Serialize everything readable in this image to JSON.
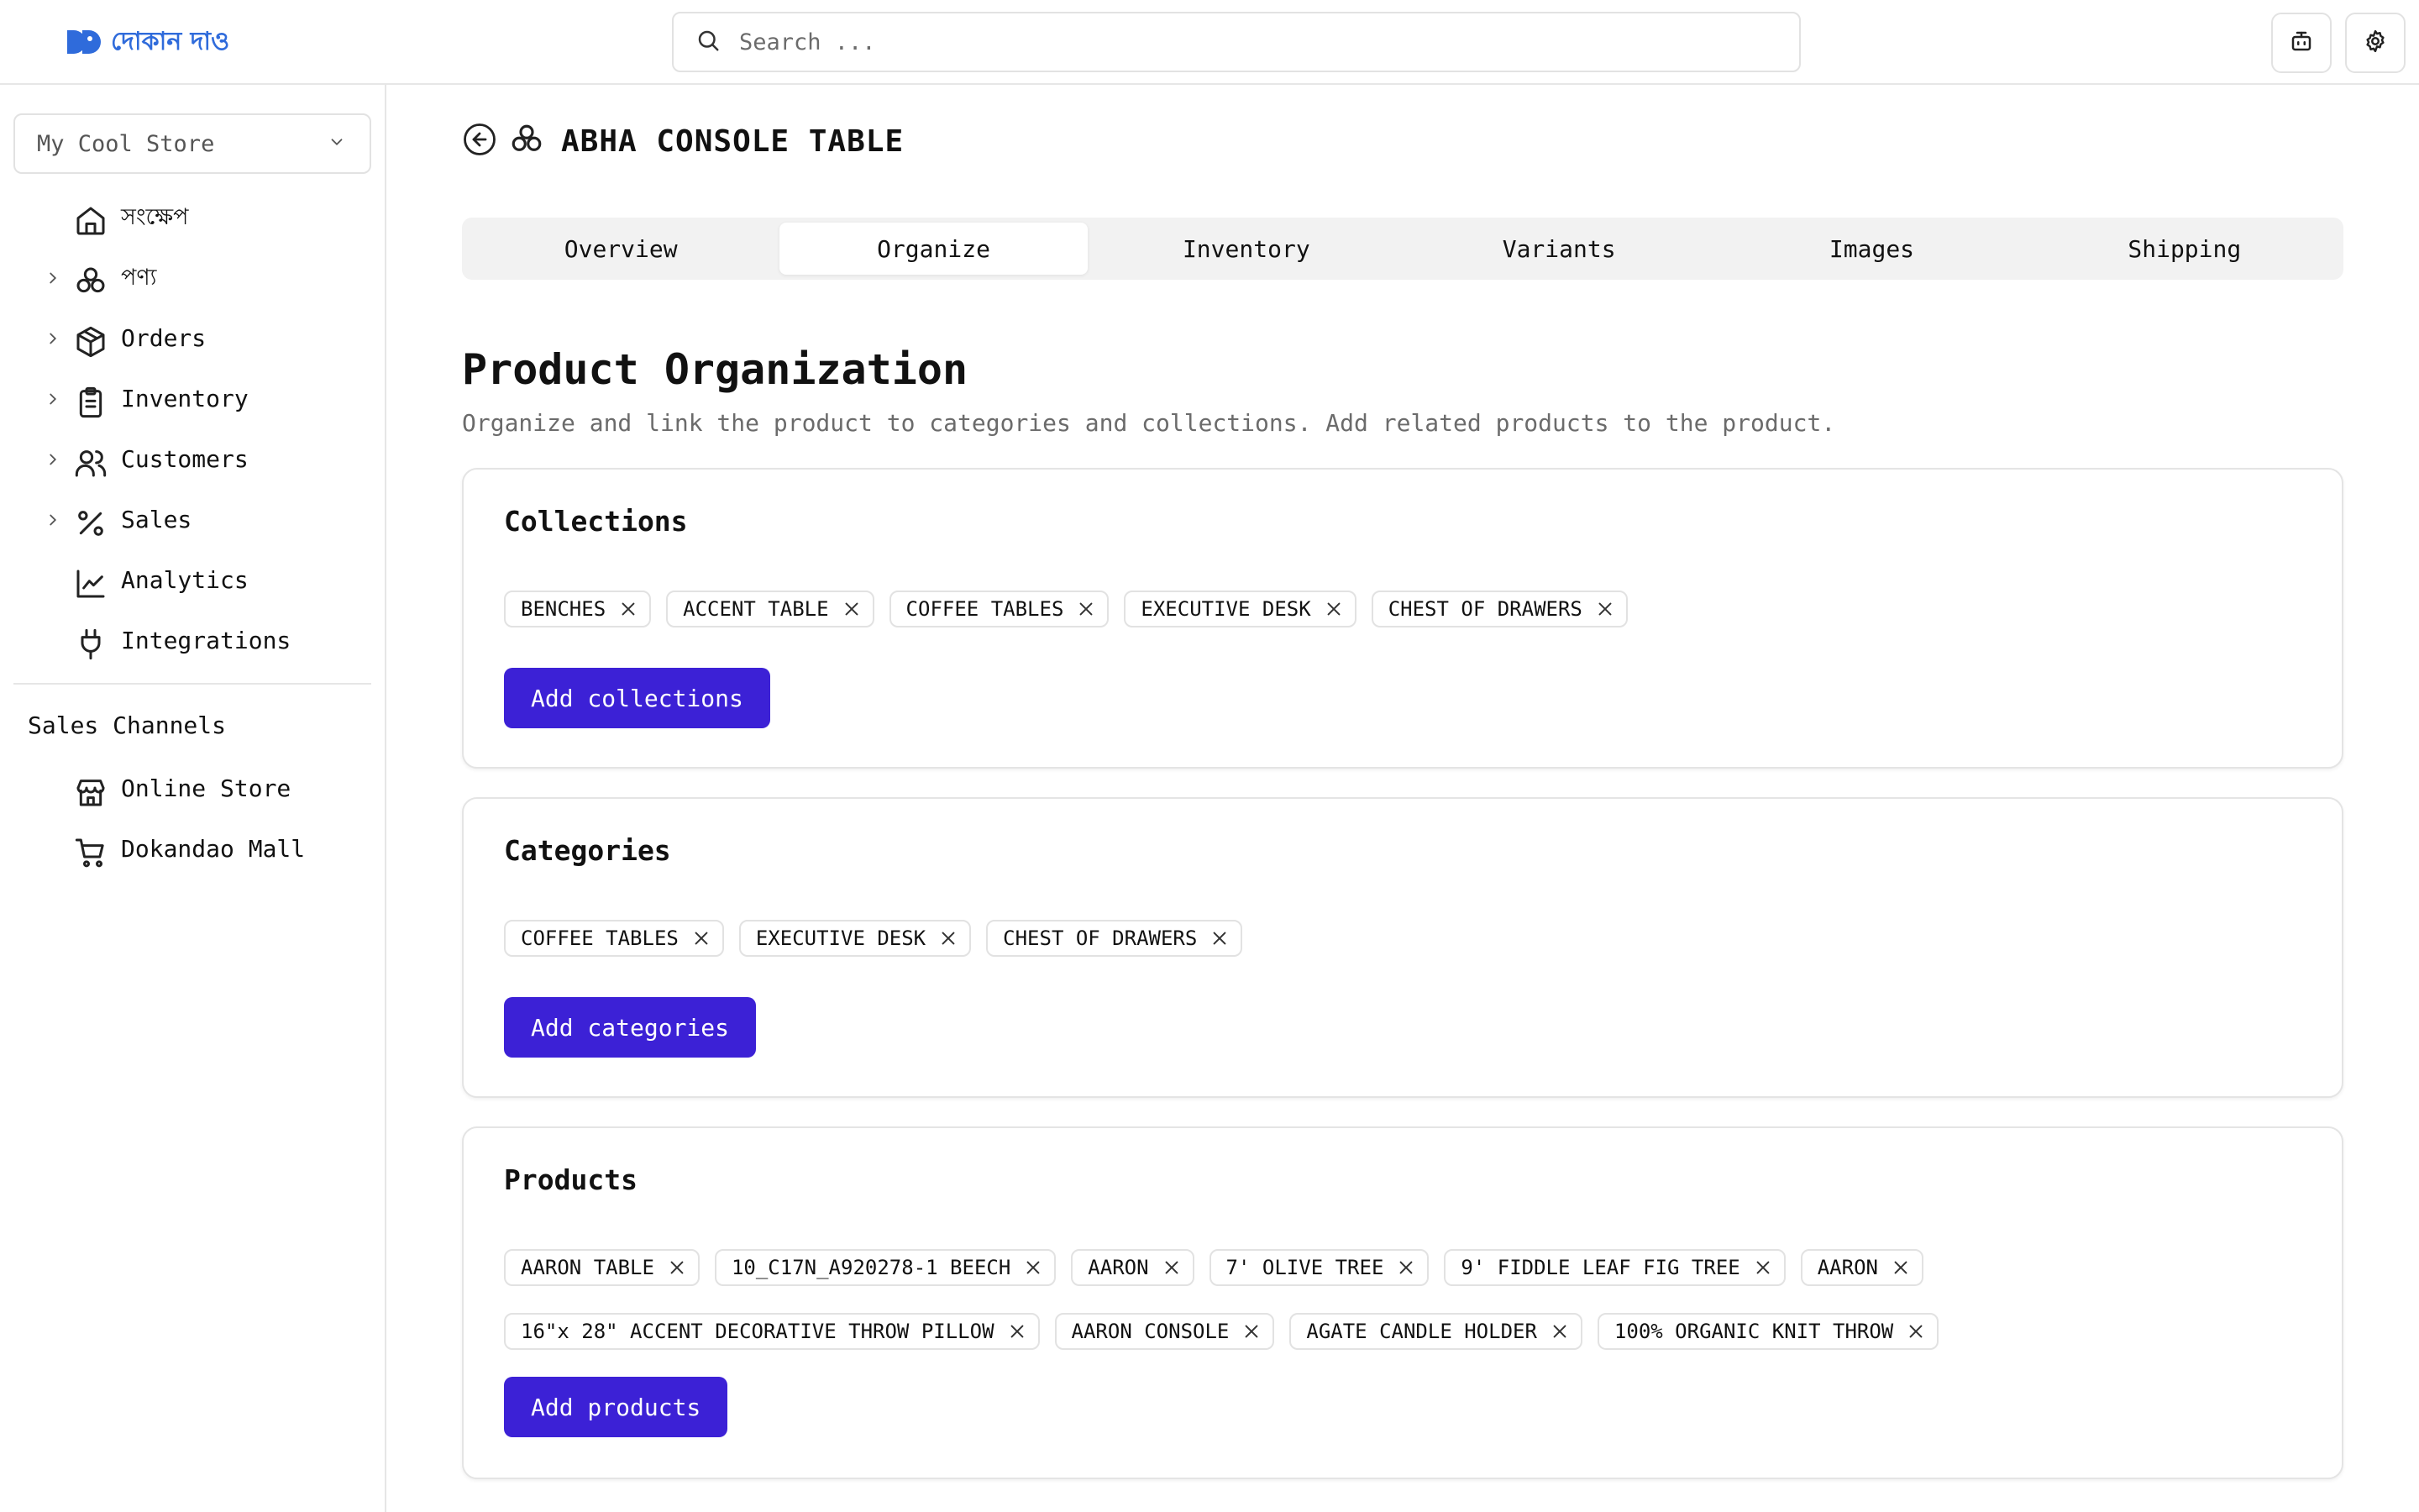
{
  "header": {
    "logo_text": "দোকান দাও",
    "search_placeholder": "Search ...",
    "brand_color": "#2f6bdb"
  },
  "sidebar": {
    "store": "My Cool Store",
    "items": [
      {
        "label": "সংক্ষেপ",
        "icon": "home-icon",
        "expandable": false
      },
      {
        "label": "পণ্য",
        "icon": "boxes-icon",
        "expandable": true
      },
      {
        "label": "Orders",
        "icon": "package-icon",
        "expandable": true
      },
      {
        "label": "Inventory",
        "icon": "clipboard-icon",
        "expandable": true
      },
      {
        "label": "Customers",
        "icon": "users-icon",
        "expandable": true
      },
      {
        "label": "Sales",
        "icon": "percent-icon",
        "expandable": true
      },
      {
        "label": "Analytics",
        "icon": "line-chart-icon",
        "expandable": false
      },
      {
        "label": "Integrations",
        "icon": "plug-icon",
        "expandable": false
      }
    ],
    "channels_title": "Sales Channels",
    "channels": [
      {
        "label": "Online Store",
        "icon": "store-icon"
      },
      {
        "label": "Dokandao Mall",
        "icon": "cart-icon"
      }
    ]
  },
  "product": {
    "title": "ABHA CONSOLE TABLE"
  },
  "tabs": [
    {
      "label": "Overview",
      "active": false
    },
    {
      "label": "Organize",
      "active": true
    },
    {
      "label": "Inventory",
      "active": false
    },
    {
      "label": "Variants",
      "active": false
    },
    {
      "label": "Images",
      "active": false
    },
    {
      "label": "Shipping",
      "active": false
    }
  ],
  "section": {
    "title": "Product Organization",
    "description": "Organize and link the product to categories and collections. Add related products to the product."
  },
  "collections": {
    "title": "Collections",
    "chips": [
      "BENCHES",
      "ACCENT TABLE",
      "COFFEE TABLES",
      "EXECUTIVE DESK",
      "CHEST OF DRAWERS"
    ],
    "button": "Add collections"
  },
  "categories": {
    "title": "Categories",
    "chips": [
      "COFFEE TABLES",
      "EXECUTIVE DESK",
      "CHEST OF DRAWERS"
    ],
    "button": "Add categories"
  },
  "products": {
    "title": "Products",
    "chips": [
      "AARON TABLE",
      "10_C17N_A920278-1 BEECH",
      "AARON",
      "7' OLIVE TREE",
      "9' FIDDLE LEAF FIG TREE",
      "AARON",
      "16\"x 28\" ACCENT DECORATIVE THROW PILLOW",
      "AARON CONSOLE",
      "AGATE CANDLE HOLDER",
      "100% ORGANIC KNIT THROW"
    ],
    "button": "Add products"
  },
  "accent_color": "#3c21d6"
}
